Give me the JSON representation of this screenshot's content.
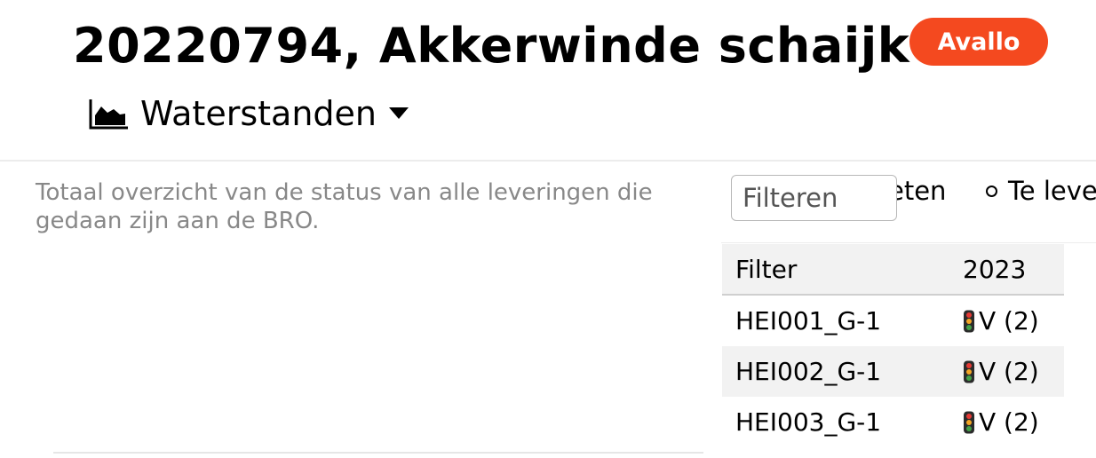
{
  "header": {
    "title": "20220794, Akkerwinde schaijk",
    "badge": "Avallo",
    "selector_label": "Waterstanden",
    "selector_icon": "area-chart-icon"
  },
  "main": {
    "description": "Totaal overzicht van de status van alle leveringen die gedaan zijn aan de BRO."
  },
  "filter": {
    "placeholder": "Filteren",
    "option_1_label": "eten",
    "option_2_label": "Te leve"
  },
  "table": {
    "columns": [
      "Filter",
      "2023"
    ],
    "rows": [
      {
        "filter": "HEI001_G-1",
        "status": "V (2)"
      },
      {
        "filter": "HEI002_G-1",
        "status": "V (2)"
      },
      {
        "filter": "HEI003_G-1",
        "status": "V (2)"
      }
    ]
  },
  "colors": {
    "badge": "#f4491f",
    "description_text": "#888888",
    "row_alt": "#f2f2f2",
    "traffic_light_red": "#e53935",
    "traffic_light_amber": "#f5a623",
    "traffic_light_green": "#43a047"
  }
}
